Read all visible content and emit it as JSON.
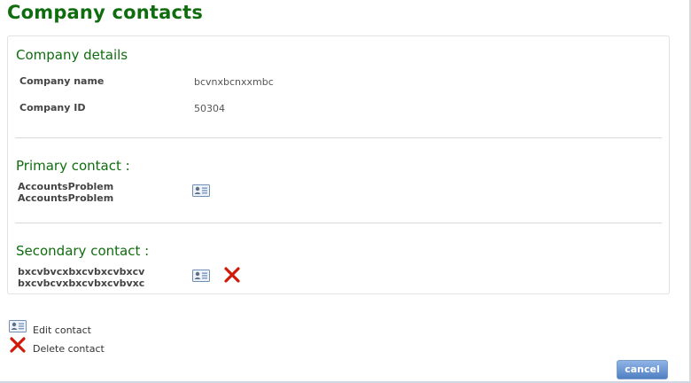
{
  "page": {
    "title": "Company contacts"
  },
  "company_details": {
    "heading": "Company details",
    "rows": [
      {
        "label": "Company name",
        "value": "bcvnxbcnxxmbc"
      },
      {
        "label": "Company ID",
        "value": "50304"
      }
    ]
  },
  "primary_contact": {
    "heading": "Primary contact :",
    "name_line1": "AccountsProblem",
    "name_line2": "AccountsProblem",
    "icons": [
      "contact-card-icon"
    ]
  },
  "secondary_contact": {
    "heading": "Secondary contact :",
    "name_line1": "bxcvbvcxbxcvbxcvbxcv",
    "name_line2": "bxcvbcvxbxcvbxcvbvxc",
    "icons": [
      "contact-card-icon",
      "delete-x-icon"
    ]
  },
  "legend": {
    "edit_label": "Edit contact",
    "delete_label": "Delete contact"
  },
  "actions": {
    "cancel_label": "cancel"
  },
  "colors": {
    "heading_green": "#0f6d0f",
    "delete_red": "#d11a0a",
    "button_blue": "#5a88c9"
  }
}
